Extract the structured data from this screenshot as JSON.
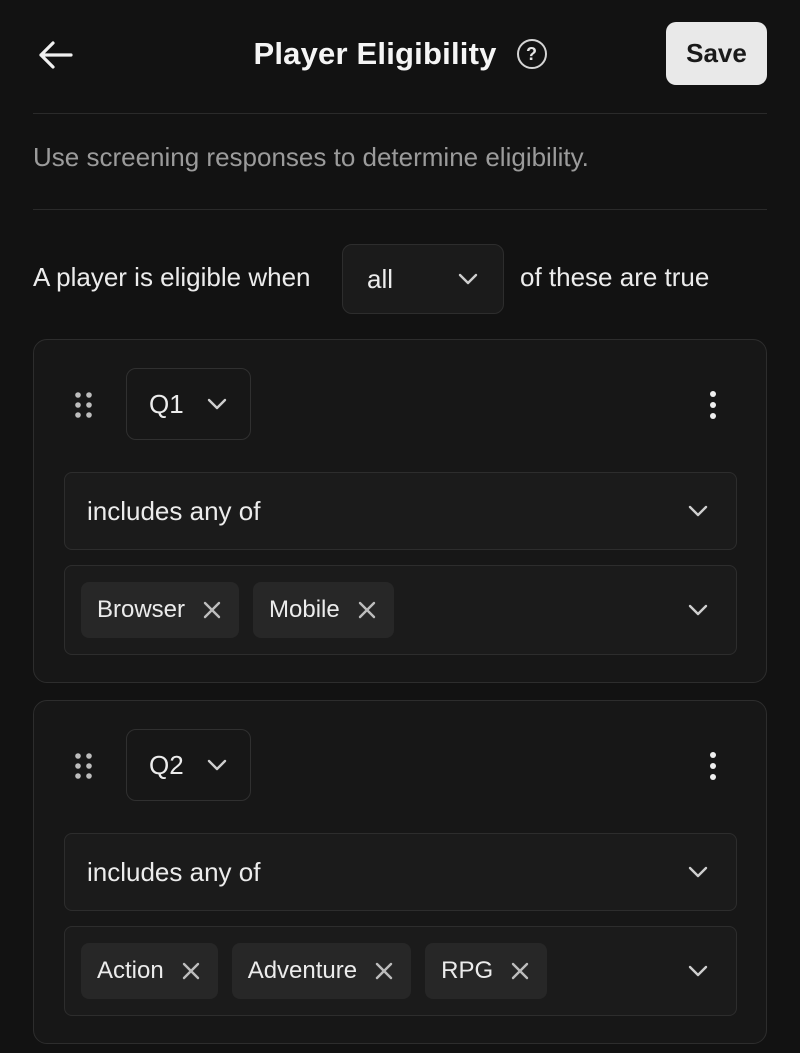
{
  "header": {
    "title": "Player Eligibility",
    "help_glyph": "?",
    "save_label": "Save",
    "back_icon": "arrow-left-icon",
    "help_icon": "question-circle-icon"
  },
  "description": "Use screening responses to determine eligibility.",
  "rule": {
    "prefix": "A player is eligible when",
    "mode": "all",
    "suffix": "of these are true"
  },
  "conditions": [
    {
      "question": "Q1",
      "operator": "includes any of",
      "values": [
        "Browser",
        "Mobile"
      ]
    },
    {
      "question": "Q2",
      "operator": "includes any of",
      "values": [
        "Action",
        "Adventure",
        "RPG"
      ]
    }
  ],
  "colors": {
    "background": "#121212",
    "card": "#171717",
    "save_button": "#e9e9e9",
    "tag": "#272727"
  }
}
